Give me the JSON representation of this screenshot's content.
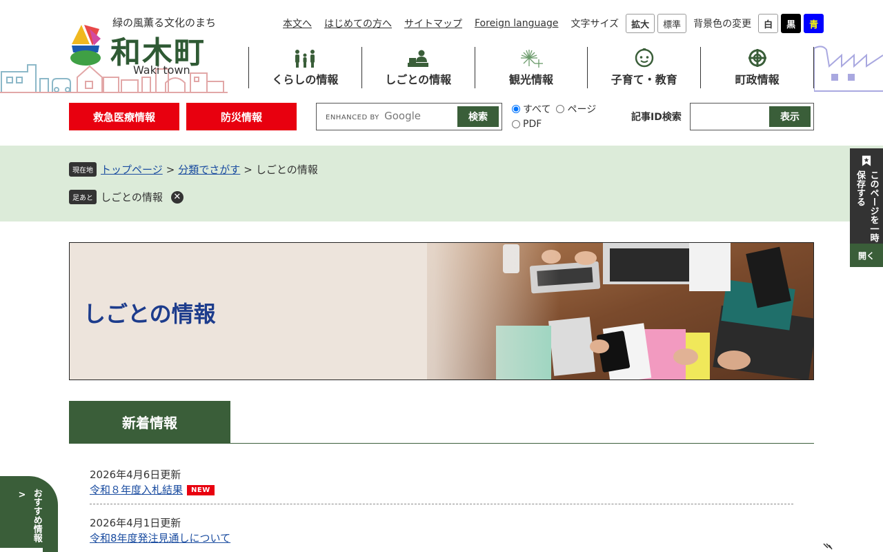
{
  "site": {
    "tagline": "緑の風薫る文化のまち",
    "name": "和木町",
    "name_en": "Waki town"
  },
  "util": {
    "links": [
      "本文へ",
      "はじめての方へ",
      "サイトマップ",
      "Foreign language"
    ],
    "font_size_label": "文字サイズ",
    "font_enlarge": "拡大",
    "font_standard": "標準",
    "bg_label": "背景色の変更",
    "bg_white": "白",
    "bg_black": "黒",
    "bg_blue": "青"
  },
  "gnav": [
    {
      "label": "くらしの情報",
      "icon": "family-icon"
    },
    {
      "label": "しごとの情報",
      "icon": "worker-desk-icon"
    },
    {
      "label": "観光情報",
      "icon": "fireworks-icon"
    },
    {
      "label": "子育て・教育",
      "icon": "child-face-icon"
    },
    {
      "label": "町政情報",
      "icon": "town-emblem-icon"
    }
  ],
  "emergency": {
    "medical": "救急医療情報",
    "disaster": "防災情報"
  },
  "search": {
    "brand_prefix": "ENHANCED BY",
    "brand_name": "Google",
    "button": "検索",
    "scope_all": "すべて",
    "scope_page": "ページ",
    "scope_pdf": "PDF"
  },
  "article_id": {
    "label": "記事ID検索",
    "button": "表示"
  },
  "breadcrumb": {
    "current_tag": "現在地",
    "items": [
      "トップページ",
      "分類でさがす"
    ],
    "current": "しごとの情報",
    "separator": ">",
    "history_tag": "足あと",
    "history_item": "しごとの情報"
  },
  "hero": {
    "title": "しごとの情報"
  },
  "news": {
    "heading": "新着情報",
    "items": [
      {
        "date": "2026年4月6日更新",
        "title": "令和８年度入札結果",
        "badge": "NEW"
      },
      {
        "date": "2026年4月1日更新",
        "title": "令和8年度発注見通しについて",
        "badge": ""
      }
    ]
  },
  "bookmark": {
    "text": "このページを一時保存する",
    "open": "開く"
  },
  "recommend": {
    "text": "おすすめ情報",
    "arrow": ">"
  },
  "colors": {
    "brand_green": "#3a5e39",
    "emergency_red": "#e8000f",
    "crumb_bg": "#dcebd9",
    "title_blue": "#1d3c8c",
    "link_blue": "#1a4ca0"
  }
}
